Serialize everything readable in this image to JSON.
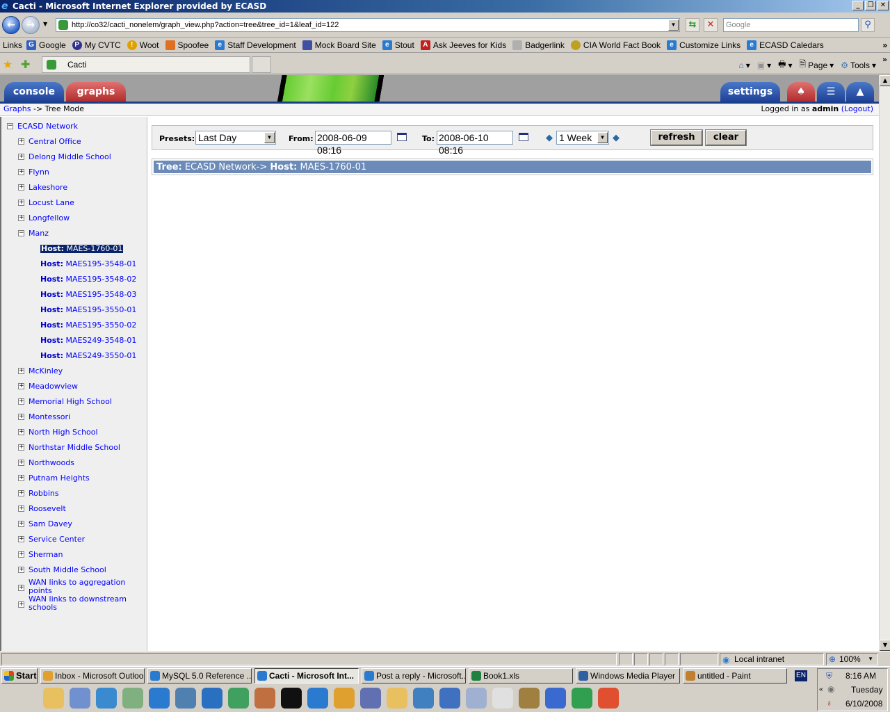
{
  "window": {
    "title": "Cacti - Microsoft Internet Explorer provided by ECASD",
    "controls": [
      "minimize",
      "restore",
      "close"
    ]
  },
  "browser": {
    "address": "http://co32/cacti_nonelem/graph_view.php?action=tree&tree_id=1&leaf_id=122",
    "search_placeholder": "Google",
    "links_label": "Links",
    "links": [
      {
        "label": "Google",
        "icon": "google-icon",
        "color": "#3060c0"
      },
      {
        "label": "My CVTC",
        "icon": "cvtc-icon",
        "color": "#303090"
      },
      {
        "label": "Woot",
        "icon": "woot-icon",
        "color": "#e0a000"
      },
      {
        "label": "Spoofee",
        "icon": "spoofee-icon",
        "color": "#e07020"
      },
      {
        "label": "Staff Development",
        "icon": "ie-icon",
        "color": "#2a7ad0"
      },
      {
        "label": "Mock Board Site",
        "icon": "site-icon",
        "color": "#4050a0"
      },
      {
        "label": "Stout",
        "icon": "ie-icon",
        "color": "#2a7ad0"
      },
      {
        "label": "Ask Jeeves for Kids",
        "icon": "askjeeves-icon",
        "color": "#c02020"
      },
      {
        "label": "Badgerlink",
        "icon": "badger-icon",
        "color": "#808080"
      },
      {
        "label": "CIA World Fact Book",
        "icon": "cia-icon",
        "color": "#c0a020"
      },
      {
        "label": "Customize Links",
        "icon": "ie-icon",
        "color": "#2a7ad0"
      },
      {
        "label": "ECASD Caledars",
        "icon": "ie-icon",
        "color": "#2a7ad0"
      }
    ],
    "tab_title": "Cacti",
    "commands": {
      "page": "Page",
      "tools": "Tools"
    }
  },
  "cacti": {
    "tabs": {
      "console": "console",
      "graphs": "graphs",
      "settings": "settings"
    },
    "breadcrumb": {
      "root": "Graphs",
      "sep": " -> ",
      "current": "Tree Mode"
    },
    "login": {
      "prefix": "Logged in as ",
      "user": "admin",
      "open": " (",
      "logout": "Logout",
      "close": ")"
    },
    "tree": {
      "root": "ECASD Network",
      "branches_before": [
        "Central Office",
        "Delong Middle School",
        "Flynn",
        "Lakeshore",
        "Locust Lane",
        "Longfellow"
      ],
      "expanded": "Manz",
      "host_prefix": "Host:",
      "hosts": [
        "MAES-1760-01",
        "MAES195-3548-01",
        "MAES195-3548-02",
        "MAES195-3548-03",
        "MAES195-3550-01",
        "MAES195-3550-02",
        "MAES249-3548-01",
        "MAES249-3550-01"
      ],
      "selected_host": "MAES-1760-01",
      "branches_after": [
        "McKinley",
        "Meadowview",
        "Memorial High School",
        "Montessori",
        "North High School",
        "Northstar Middle School",
        "Northwoods",
        "Putnam Heights",
        "Robbins",
        "Roosevelt",
        "Sam Davey",
        "Service Center",
        "Sherman",
        "South Middle School"
      ],
      "wan1": [
        "WAN links to aggregation",
        "points"
      ],
      "wan2": [
        "WAN links to downstream",
        "schools"
      ]
    },
    "filter": {
      "presets_label": "Presets:",
      "preset_value": "Last Day",
      "from_label": "From:",
      "from_value": "2008-06-09 08:16",
      "to_label": "To:",
      "to_value": "2008-06-10 08:16",
      "timespan_value": "1 Week",
      "refresh": "refresh",
      "clear": "clear"
    },
    "tree_header": {
      "tree_label": "Tree:",
      "tree_value": "ECASD Network->",
      "host_label": "Host:",
      "host_value": "MAES-1760-01"
    }
  },
  "statusbar": {
    "zone": "Local intranet",
    "zoom": "100%"
  },
  "taskbar": {
    "start": "Start",
    "buttons": [
      {
        "label": "Inbox - Microsoft Outlook",
        "color": "#e0a030"
      },
      {
        "label": "MySQL 5.0 Reference ...",
        "color": "#2a7ad0"
      },
      {
        "label": "Cacti - Microsoft Int...",
        "color": "#2a7ad0",
        "active": true
      },
      {
        "label": "Post a reply - Microsoft...",
        "color": "#2a7ad0"
      },
      {
        "label": "Book1.xls",
        "color": "#208040"
      },
      {
        "label": "Windows Media Player",
        "color": "#3060a0"
      },
      {
        "label": "untitled - Paint",
        "color": "#c08030"
      }
    ],
    "lang": "EN",
    "clock": {
      "time": "8:16 AM",
      "day": "Tuesday",
      "date": "6/10/2008"
    }
  }
}
